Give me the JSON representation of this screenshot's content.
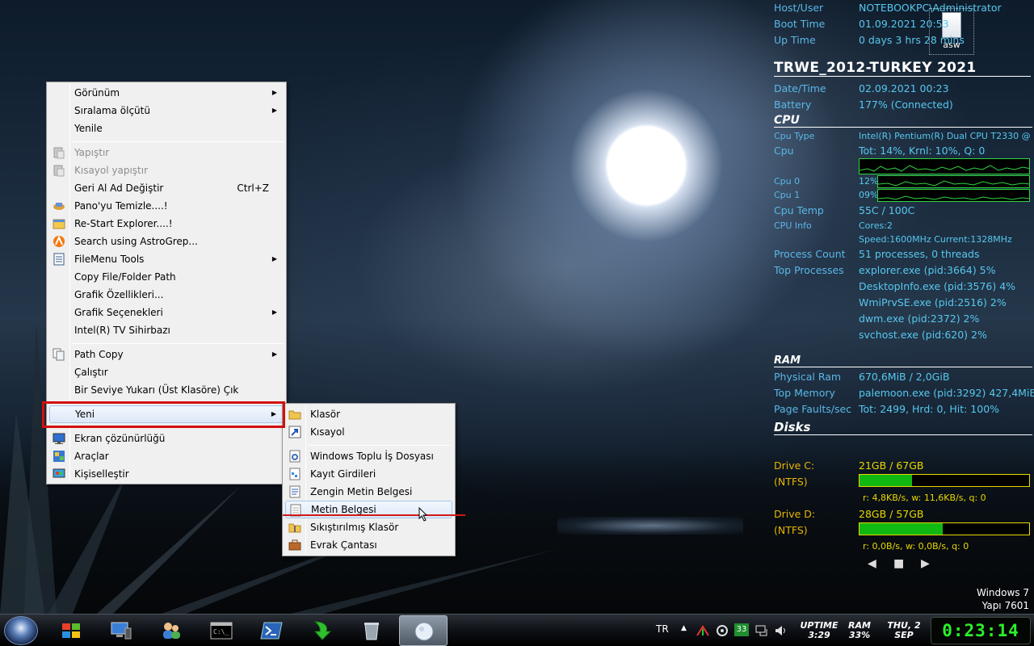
{
  "desktop_icon": {
    "label": "asw"
  },
  "info": {
    "host_user": {
      "key": "Host/User",
      "value": "NOTEBOOKPC\\Administrator"
    },
    "boot_time": {
      "key": "Boot Time",
      "value": "01.09.2021 20:53"
    },
    "up_time": {
      "key": "Up Time",
      "value": "0 days 3 hrs 28 mins"
    },
    "title": "TRWE_2012-TURKEY 2021",
    "date_time": {
      "key": "Date/Time",
      "value": "02.09.2021 00:23"
    },
    "battery": {
      "key": "Battery",
      "value": "177% (Connected)"
    },
    "cpu_head": "CPU",
    "cpu_type": {
      "key": "Cpu Type",
      "value": "Intel(R) Pentium(R) Dual  CPU  T2330  @"
    },
    "cpu": {
      "key": "Cpu",
      "value": "Tot: 14%, Krnl: 10%, Q: 0"
    },
    "cpu0": {
      "key": "Cpu 0",
      "value": "12%"
    },
    "cpu1": {
      "key": "Cpu 1",
      "value": "09%"
    },
    "cpu_temp": {
      "key": "Cpu Temp",
      "value": "55C / 100C"
    },
    "cpu_info": {
      "key": "CPU Info",
      "value1": "Cores:2",
      "value2": "Speed:1600MHz   Current:1328MHz"
    },
    "process_count": {
      "key": "Process Count",
      "value": "51 processes, 0 threads"
    },
    "top_processes": {
      "key": "Top Processes",
      "values": [
        "explorer.exe (pid:3664) 5%",
        "DesktopInfo.exe (pid:3576) 4%",
        "WmiPrvSE.exe (pid:2516) 2%",
        "dwm.exe (pid:2372) 2%",
        "svchost.exe (pid:620) 2%"
      ]
    },
    "ram_head": "RAM",
    "physical_ram": {
      "key": "Physical Ram",
      "value": "670,6MiB / 2,0GiB"
    },
    "top_memory": {
      "key": "Top Memory",
      "value": "palemoon.exe (pid:3292) 427,4MiB"
    },
    "page_faults": {
      "key": "Page Faults/sec",
      "value": "Tot: 2499, Hrd: 0, Hit: 100%"
    },
    "disks_head": "Disks",
    "drive_c": {
      "key": "Drive C:",
      "fs": "(NTFS)",
      "value": "21GB / 67GB",
      "used_fraction": 0.31,
      "io": "r: 4,8KB/s, w: 11,6KB/s, q: 0"
    },
    "drive_d": {
      "key": "Drive D:",
      "fs": "(NTFS)",
      "value": "28GB / 57GB",
      "used_fraction": 0.49,
      "io": "r: 0,0B/s, w: 0,0B/s, q: 0"
    },
    "nav": {
      "prev": "◀",
      "stop": "■",
      "next": "▶"
    },
    "colors": {
      "key": "#59b8e8",
      "drive": "#e8b400",
      "graph": "#2fd33f",
      "bar_fill": "#12b812"
    }
  },
  "windows_info": {
    "line1": "Windows 7",
    "line2": "Yapı 7601"
  },
  "context_menu": {
    "view": "Görünüm",
    "sort_by": "Sıralama ölçütü",
    "refresh": "Yenile",
    "paste": "Yapıştır",
    "paste_shortcut": "Kısayol yapıştır",
    "undo_rename": "Geri Al Ad Değiştir",
    "undo_shortcut": "Ctrl+Z",
    "clear_clipboard": "Pano'yu Temizle....!",
    "restart_explorer": "Re-Start Explorer....!",
    "astrogrep": "Search using AstroGrep...",
    "filemenu_tools": "FileMenu Tools",
    "copy_path": "Copy File/Folder Path",
    "graphics_props": "Grafik Özellikleri...",
    "graphics_options": "Grafik Seçenekleri",
    "intel_tv": "Intel(R) TV Sihirbazı",
    "path_copy": "Path Copy",
    "run": "Çalıştır",
    "one_level_up": "Bir Seviye Yukarı (Üst Klasöre) Çık",
    "new": "Yeni",
    "screen_resolution": "Ekran çözünürlüğü",
    "tools": "Araçlar",
    "personalize": "Kişiselleştir"
  },
  "new_submenu": {
    "folder": "Klasör",
    "shortcut": "Kısayol",
    "batch_file": "Windows Toplu İş Dosyası",
    "registry": "Kayıt Girdileri",
    "rich_text": "Zengin Metin Belgesi",
    "text_doc": "Metin Belgesi",
    "zip": "Sıkıştırılmış Klasör",
    "briefcase": "Evrak Çantası"
  },
  "taskbar": {
    "lang": "TR",
    "tray_badge": "33",
    "uptime_label": "UPTIME",
    "uptime_value": "3:29",
    "ram_label": "RAM",
    "ram_value": "33%",
    "day": "THU, 2",
    "month": "SEP",
    "clock": "0:23:14"
  }
}
